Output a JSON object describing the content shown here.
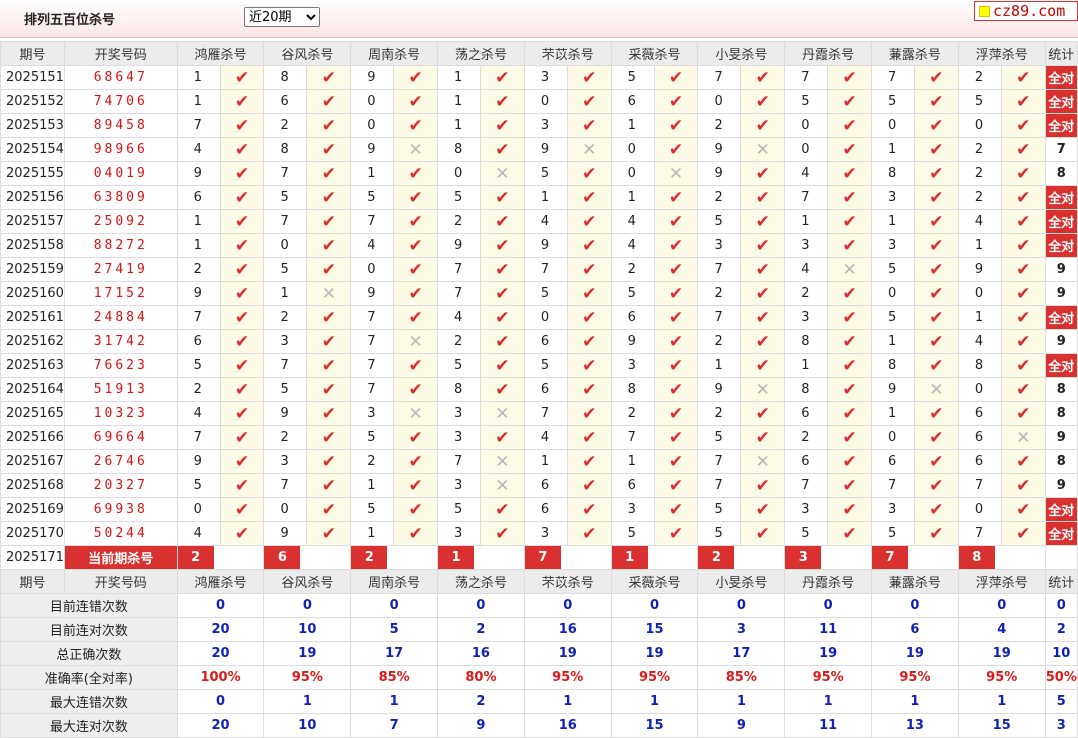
{
  "header": {
    "title": "排列五百位杀号",
    "period_select": "近20期",
    "logo_text": "cz89.com"
  },
  "colors": {
    "ok": "#e0292c",
    "no": "#b8b8b8",
    "badge": "#d93030",
    "stat_blue": "#1022b5",
    "stat_red": "#e01818"
  },
  "columns": {
    "period": "期号",
    "winning": "开奖号码",
    "stat": "统计"
  },
  "experts": [
    "鸿雁杀号",
    "谷风杀号",
    "周南杀号",
    "荡之杀号",
    "芣苡杀号",
    "采薇杀号",
    "小旻杀号",
    "丹霞杀号",
    "蒹露杀号",
    "浮萍杀号"
  ],
  "rows": [
    {
      "period": "2025151",
      "num": "68647",
      "kills": [
        "1",
        "8",
        "9",
        "1",
        "3",
        "5",
        "7",
        "7",
        "7",
        "2"
      ],
      "hits": [
        1,
        1,
        1,
        1,
        1,
        1,
        1,
        1,
        1,
        1
      ],
      "stat": "全对"
    },
    {
      "period": "2025152",
      "num": "74706",
      "kills": [
        "1",
        "6",
        "0",
        "1",
        "0",
        "6",
        "0",
        "5",
        "5",
        "5"
      ],
      "hits": [
        1,
        1,
        1,
        1,
        1,
        1,
        1,
        1,
        1,
        1
      ],
      "stat": "全对"
    },
    {
      "period": "2025153",
      "num": "89458",
      "kills": [
        "7",
        "2",
        "0",
        "1",
        "3",
        "1",
        "2",
        "0",
        "0",
        "0"
      ],
      "hits": [
        1,
        1,
        1,
        1,
        1,
        1,
        1,
        1,
        1,
        1
      ],
      "stat": "全对"
    },
    {
      "period": "2025154",
      "num": "98966",
      "kills": [
        "4",
        "8",
        "9",
        "8",
        "9",
        "0",
        "9",
        "0",
        "1",
        "2"
      ],
      "hits": [
        1,
        1,
        0,
        1,
        0,
        1,
        0,
        1,
        1,
        1
      ],
      "stat": "7"
    },
    {
      "period": "2025155",
      "num": "04019",
      "kills": [
        "9",
        "7",
        "1",
        "0",
        "5",
        "0",
        "9",
        "4",
        "8",
        "2"
      ],
      "hits": [
        1,
        1,
        1,
        0,
        1,
        0,
        1,
        1,
        1,
        1
      ],
      "stat": "8"
    },
    {
      "period": "2025156",
      "num": "63809",
      "kills": [
        "6",
        "5",
        "5",
        "5",
        "1",
        "1",
        "2",
        "7",
        "3",
        "2"
      ],
      "hits": [
        1,
        1,
        1,
        1,
        1,
        1,
        1,
        1,
        1,
        1
      ],
      "stat": "全对"
    },
    {
      "period": "2025157",
      "num": "25092",
      "kills": [
        "1",
        "7",
        "7",
        "2",
        "4",
        "4",
        "5",
        "1",
        "1",
        "4"
      ],
      "hits": [
        1,
        1,
        1,
        1,
        1,
        1,
        1,
        1,
        1,
        1
      ],
      "stat": "全对"
    },
    {
      "period": "2025158",
      "num": "88272",
      "kills": [
        "1",
        "0",
        "4",
        "9",
        "9",
        "4",
        "3",
        "3",
        "3",
        "1"
      ],
      "hits": [
        1,
        1,
        1,
        1,
        1,
        1,
        1,
        1,
        1,
        1
      ],
      "stat": "全对"
    },
    {
      "period": "2025159",
      "num": "27419",
      "kills": [
        "2",
        "5",
        "0",
        "7",
        "7",
        "2",
        "7",
        "4",
        "5",
        "9"
      ],
      "hits": [
        1,
        1,
        1,
        1,
        1,
        1,
        1,
        0,
        1,
        1
      ],
      "stat": "9"
    },
    {
      "period": "2025160",
      "num": "17152",
      "kills": [
        "9",
        "1",
        "9",
        "7",
        "5",
        "5",
        "2",
        "2",
        "0",
        "0"
      ],
      "hits": [
        1,
        0,
        1,
        1,
        1,
        1,
        1,
        1,
        1,
        1
      ],
      "stat": "9"
    },
    {
      "period": "2025161",
      "num": "24884",
      "kills": [
        "7",
        "2",
        "7",
        "4",
        "0",
        "6",
        "7",
        "3",
        "5",
        "1"
      ],
      "hits": [
        1,
        1,
        1,
        1,
        1,
        1,
        1,
        1,
        1,
        1
      ],
      "stat": "全对"
    },
    {
      "period": "2025162",
      "num": "31742",
      "kills": [
        "6",
        "3",
        "7",
        "2",
        "6",
        "9",
        "2",
        "8",
        "1",
        "4"
      ],
      "hits": [
        1,
        1,
        0,
        1,
        1,
        1,
        1,
        1,
        1,
        1
      ],
      "stat": "9"
    },
    {
      "period": "2025163",
      "num": "76623",
      "kills": [
        "5",
        "7",
        "7",
        "5",
        "5",
        "3",
        "1",
        "1",
        "8",
        "8"
      ],
      "hits": [
        1,
        1,
        1,
        1,
        1,
        1,
        1,
        1,
        1,
        1
      ],
      "stat": "全对"
    },
    {
      "period": "2025164",
      "num": "51913",
      "kills": [
        "2",
        "5",
        "7",
        "8",
        "6",
        "8",
        "9",
        "8",
        "9",
        "0"
      ],
      "hits": [
        1,
        1,
        1,
        1,
        1,
        1,
        0,
        1,
        0,
        1
      ],
      "stat": "8"
    },
    {
      "period": "2025165",
      "num": "10323",
      "kills": [
        "4",
        "9",
        "3",
        "3",
        "7",
        "2",
        "2",
        "6",
        "1",
        "6"
      ],
      "hits": [
        1,
        1,
        0,
        0,
        1,
        1,
        1,
        1,
        1,
        1
      ],
      "stat": "8"
    },
    {
      "period": "2025166",
      "num": "69664",
      "kills": [
        "7",
        "2",
        "5",
        "3",
        "4",
        "7",
        "5",
        "2",
        "0",
        "6"
      ],
      "hits": [
        1,
        1,
        1,
        1,
        1,
        1,
        1,
        1,
        1,
        0
      ],
      "stat": "9"
    },
    {
      "period": "2025167",
      "num": "26746",
      "kills": [
        "9",
        "3",
        "2",
        "7",
        "1",
        "1",
        "7",
        "6",
        "6",
        "6"
      ],
      "hits": [
        1,
        1,
        1,
        0,
        1,
        1,
        0,
        1,
        1,
        1
      ],
      "stat": "8"
    },
    {
      "period": "2025168",
      "num": "20327",
      "kills": [
        "5",
        "7",
        "1",
        "3",
        "6",
        "6",
        "7",
        "7",
        "7",
        "7"
      ],
      "hits": [
        1,
        1,
        1,
        0,
        1,
        1,
        1,
        1,
        1,
        1
      ],
      "stat": "9"
    },
    {
      "period": "2025169",
      "num": "69938",
      "kills": [
        "0",
        "0",
        "5",
        "5",
        "6",
        "3",
        "5",
        "3",
        "3",
        "0"
      ],
      "hits": [
        1,
        1,
        1,
        1,
        1,
        1,
        1,
        1,
        1,
        1
      ],
      "stat": "全对"
    },
    {
      "period": "2025170",
      "num": "50244",
      "kills": [
        "4",
        "9",
        "1",
        "3",
        "3",
        "5",
        "5",
        "5",
        "5",
        "7"
      ],
      "hits": [
        1,
        1,
        1,
        1,
        1,
        1,
        1,
        1,
        1,
        1
      ],
      "stat": "全对"
    }
  ],
  "current": {
    "period": "2025171",
    "label": "当前期杀号",
    "kills": [
      "2",
      "6",
      "2",
      "1",
      "7",
      "1",
      "2",
      "3",
      "7",
      "8"
    ]
  },
  "stats": [
    {
      "label": "目前连错次数",
      "values": [
        "0",
        "0",
        "0",
        "0",
        "0",
        "0",
        "0",
        "0",
        "0",
        "0"
      ],
      "total": "0",
      "red": false
    },
    {
      "label": "目前连对次数",
      "values": [
        "20",
        "10",
        "5",
        "2",
        "16",
        "15",
        "3",
        "11",
        "6",
        "4"
      ],
      "total": "2",
      "red": false
    },
    {
      "label": "总正确次数",
      "values": [
        "20",
        "19",
        "17",
        "16",
        "19",
        "19",
        "17",
        "19",
        "19",
        "19"
      ],
      "total": "10",
      "red": false
    },
    {
      "label": "准确率(全对率)",
      "values": [
        "100%",
        "95%",
        "85%",
        "80%",
        "95%",
        "95%",
        "85%",
        "95%",
        "95%",
        "95%"
      ],
      "total": "50%",
      "red": true
    },
    {
      "label": "最大连错次数",
      "values": [
        "0",
        "1",
        "1",
        "2",
        "1",
        "1",
        "1",
        "1",
        "1",
        "1"
      ],
      "total": "5",
      "red": false
    },
    {
      "label": "最大连对次数",
      "values": [
        "20",
        "10",
        "7",
        "9",
        "16",
        "15",
        "9",
        "11",
        "13",
        "15"
      ],
      "total": "3",
      "red": false
    }
  ]
}
